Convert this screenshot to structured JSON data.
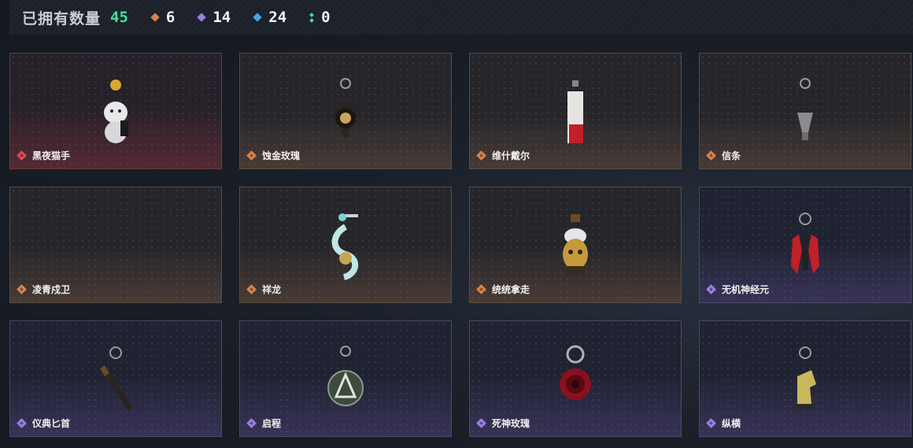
{
  "header": {
    "owned_label": "已拥有数量",
    "owned_count": "45",
    "stats": [
      {
        "icon": "gold-rarity-icon",
        "color": "#d7834a",
        "value": "6"
      },
      {
        "icon": "purple-rarity-icon",
        "color": "#9b7ee0",
        "value": "14"
      },
      {
        "icon": "blue-rarity-icon",
        "color": "#4aa3e8",
        "value": "24"
      },
      {
        "icon": "green-rarity-icon",
        "color": "#3fe0a0",
        "value": "0"
      }
    ]
  },
  "items": [
    {
      "name": "黑夜猫手",
      "rarity": "red"
    },
    {
      "name": "蚀金玫瑰",
      "rarity": "gold"
    },
    {
      "name": "维什戴尔",
      "rarity": "gold"
    },
    {
      "name": "信条",
      "rarity": "gold"
    },
    {
      "name": "凌青戍卫",
      "rarity": "gold"
    },
    {
      "name": "祥龙",
      "rarity": "gold"
    },
    {
      "name": "统统拿走",
      "rarity": "gold"
    },
    {
      "name": "无机神经元",
      "rarity": "purple"
    },
    {
      "name": "仪典匕首",
      "rarity": "purple"
    },
    {
      "name": "启程",
      "rarity": "purple"
    },
    {
      "name": "死神玫瑰",
      "rarity": "purple"
    },
    {
      "name": "纵横",
      "rarity": "purple"
    }
  ]
}
